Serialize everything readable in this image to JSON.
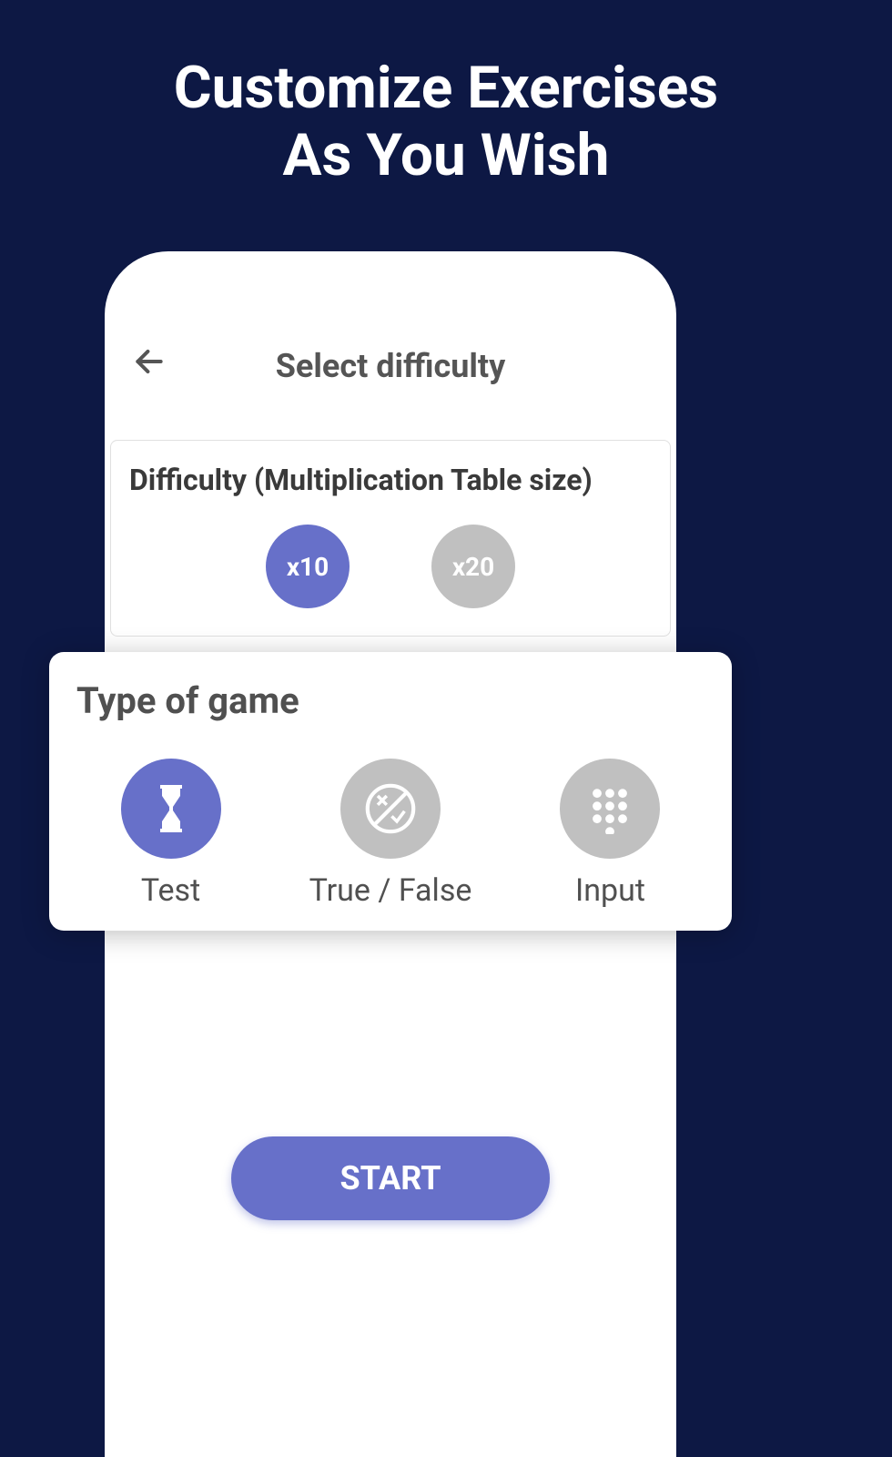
{
  "promo": {
    "title_line1": "Customize Exercises",
    "title_line2": "As You Wish"
  },
  "header": {
    "title": "Select difficulty"
  },
  "difficulty_card": {
    "title": "Difficulty (Multiplication Table size)",
    "options": [
      {
        "label": "x10",
        "selected": true
      },
      {
        "label": "x20",
        "selected": false
      }
    ]
  },
  "game_type_card": {
    "title": "Type of game",
    "options": [
      {
        "label": "Test",
        "icon": "hourglass",
        "selected": true
      },
      {
        "label": "True / False",
        "icon": "truefalse",
        "selected": false
      },
      {
        "label": "Input",
        "icon": "keypad",
        "selected": false
      }
    ]
  },
  "start_button": {
    "label": "START"
  }
}
